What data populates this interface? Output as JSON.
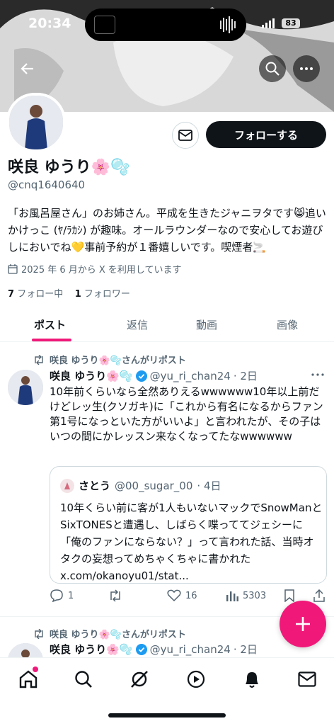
{
  "status_bar": {
    "time": "20:34",
    "battery": "83"
  },
  "profile": {
    "name": "咲良 ゆうり🌸🫧",
    "handle": "@cnq1640640",
    "bio": "「お風呂屋さん」のお姉さん。平成を生きたジャニヲタです😸追いかけっこ (ﾔ/ﾗｶｼ) が趣味。オールラウンダーなので安心してお遊びしにおいでね💛事前予約が１番嬉しいです。喫煙者🚬",
    "joined": "2025 年 6 月から X を利用しています",
    "following_count": "7",
    "following_label": "フォロー中",
    "followers_count": "1",
    "followers_label": "フォロワー",
    "follow_button": "フォローする"
  },
  "tabs": [
    {
      "label": "ポスト",
      "active": true
    },
    {
      "label": "返信",
      "active": false
    },
    {
      "label": "動画",
      "active": false
    },
    {
      "label": "画像",
      "active": false
    }
  ],
  "posts": [
    {
      "repost_label": "咲良 ゆうり🌸🫧さんがリポスト",
      "author_name": "咲良 ゆうり🌸🫧",
      "author_handle": "@yu_ri_chan24",
      "time": "· 2日",
      "text": "10年前くらいなら全然ありえるwwwwww10年以上前だけどレッ生(クソガキ)に「これから有名になるからファン第1号になっといた方がいいよ」と言われたが、その子はいつの間にかレッスン来なくなってたなwwwwww",
      "quote": {
        "author_name": "さとう",
        "author_handle": "@00_sugar_00",
        "time": "· 4日",
        "text": "10年くらい前に客が1人もいないマックでSnowManとSixTONESと遭遇し、しばらく喋っててジェシーに「俺のファンにならない？」って言われた話、当時オタクの妄想ってめちゃくちゃに書かれた x.com/okanoyu01/stat..."
      },
      "replies": "1",
      "likes": "16",
      "views": "5303"
    },
    {
      "repost_label": "咲良 ゆうり🌸🫧さんがリポスト",
      "author_name": "咲良 ゆうり🌸🫧",
      "author_handle": "@yu_ri_chan24",
      "time": "· 2日"
    }
  ],
  "colors": {
    "accent": "#f0197a",
    "verified": "#1d9bf0",
    "text": "#0f1419",
    "muted": "#536471"
  },
  "icons": [
    "back-arrow-icon",
    "search-icon",
    "more-icon",
    "mail-icon",
    "calendar-icon",
    "repost-icon",
    "verified-icon",
    "reply-icon",
    "like-icon",
    "views-icon",
    "bookmark-icon",
    "share-icon",
    "plus-icon",
    "home-icon",
    "grok-icon",
    "play-icon",
    "bell-icon"
  ]
}
